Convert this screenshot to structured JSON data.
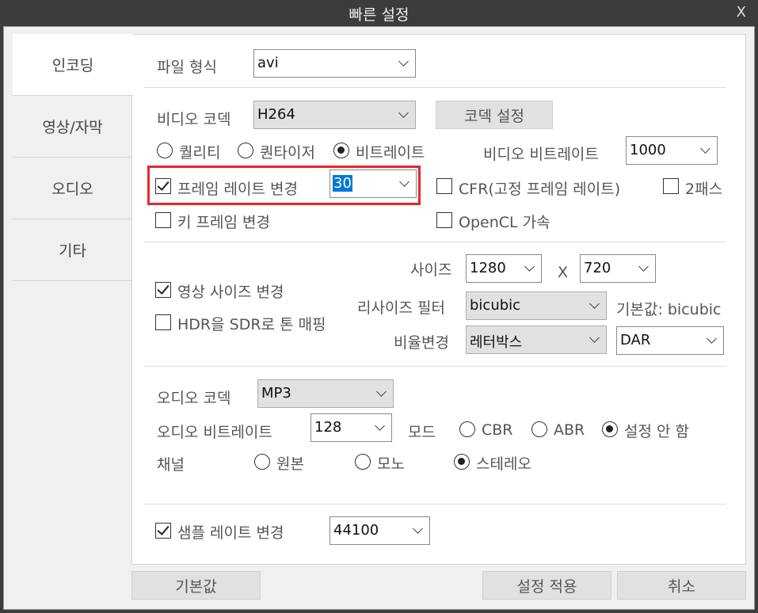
{
  "window": {
    "title": "빠른 설정",
    "close": "X"
  },
  "nav": [
    "인코딩",
    "영상/자막",
    "오디오",
    "기타"
  ],
  "video": {
    "file_format_label": "파일 형식",
    "file_format_value": "avi",
    "codec_label": "비디오 코덱",
    "codec_value": "H264",
    "codec_settings_button": "코덱 설정",
    "mode_quality": "퀄리티",
    "mode_quantizer": "퀀타이저",
    "mode_bitrate": "비트레이트",
    "bitrate_label": "비디오 비트레이트",
    "bitrate_value": "1000",
    "framerate_label": "프레임 레이트 변경",
    "framerate_value": "30",
    "cfr_label": "CFR(고정 프레임 레이트)",
    "twopass_label": "2패스",
    "keyframe_label": "키 프레임 변경",
    "opencl_label": "OpenCL 가속"
  },
  "size": {
    "change_size_label": "영상 사이즈 변경",
    "hdr_label": "HDR을 SDR로 톤 매핑",
    "size_label": "사이즈",
    "width": "1280",
    "x": "X",
    "height": "720",
    "resize_filter_label": "리사이즈 필터",
    "resize_filter_value": "bicubic",
    "default_note": "기본값: bicubic",
    "aspect_label": "비율변경",
    "aspect_value": "레터박스",
    "aspect_mode": "DAR"
  },
  "audio": {
    "codec_label": "오디오 코덱",
    "codec_value": "MP3",
    "bitrate_label": "오디오 비트레이트",
    "bitrate_value": "128",
    "mode_label": "모드",
    "cbr": "CBR",
    "abr": "ABR",
    "none": "설정 안 함",
    "channel_label": "채널",
    "original": "원본",
    "mono": "모노",
    "stereo": "스테레오",
    "samplerate_label": "샘플 레이트 변경",
    "samplerate_value": "44100"
  },
  "footer": {
    "default_button": "기본값",
    "apply_button": "설정 적용",
    "cancel_button": "취소"
  },
  "colors": {
    "highlight": "#e8262b",
    "selection": "#0078d7"
  }
}
